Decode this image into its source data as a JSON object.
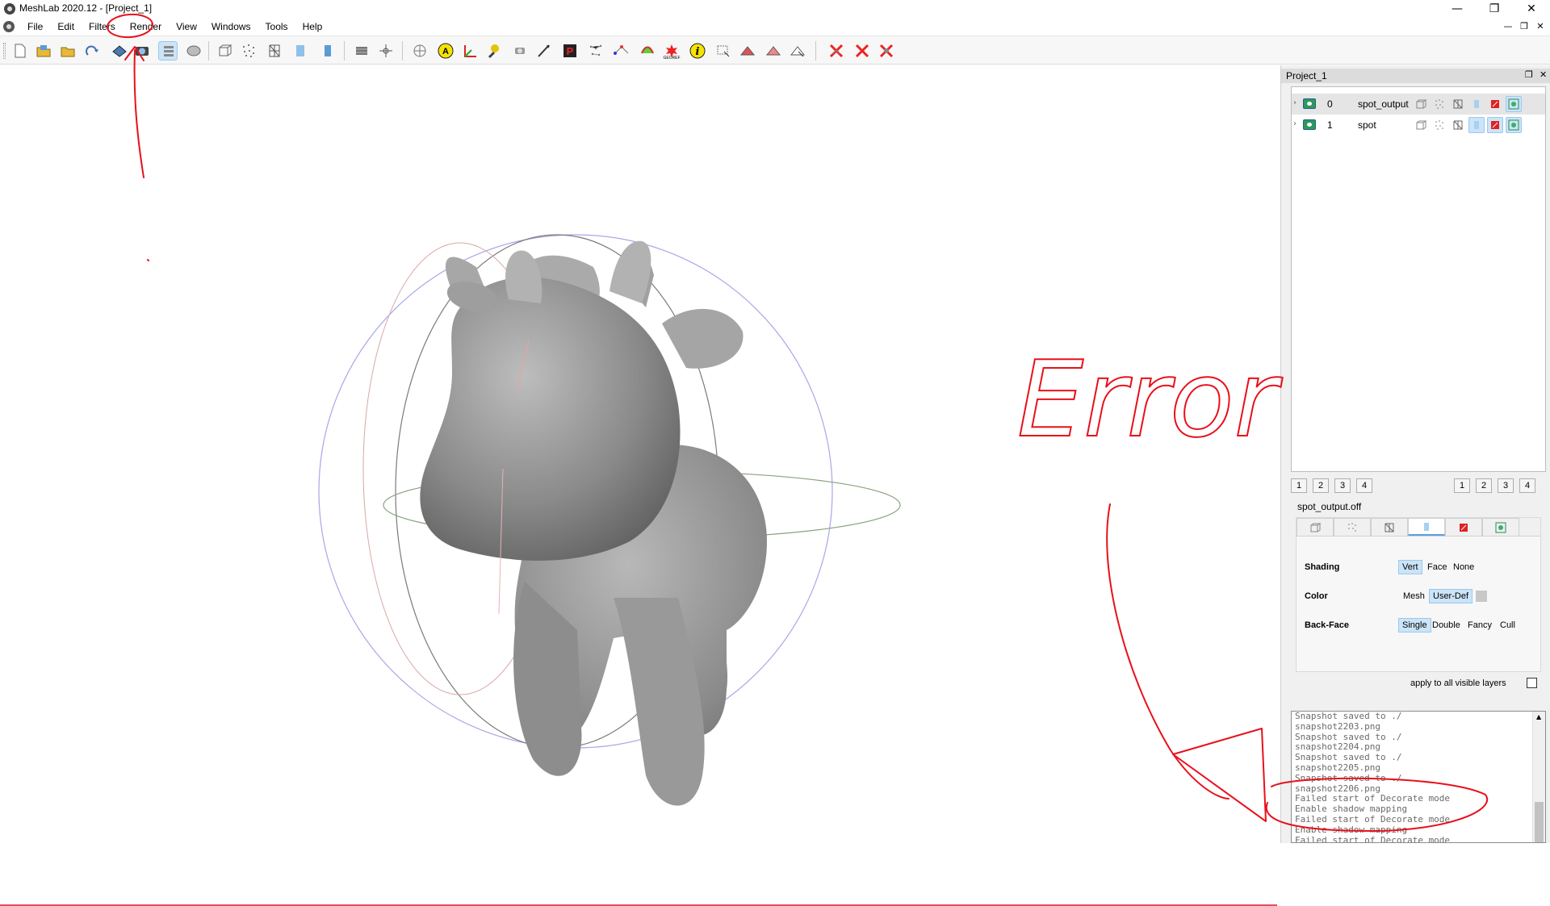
{
  "window": {
    "title": "MeshLab 2020.12 - [Project_1]",
    "controls": [
      "—",
      "❐",
      "✕"
    ],
    "mdi_controls": [
      "—",
      "❐",
      "✕"
    ]
  },
  "menu": [
    "File",
    "Edit",
    "Filters",
    "Render",
    "View",
    "Windows",
    "Tools",
    "Help"
  ],
  "toolbar_icons": [
    "new-project-icon",
    "import-mesh-icon",
    "open-project-icon",
    "reload-icon",
    "export-mesh-icon",
    "snapshot-icon",
    "fullscreen-layers-icon",
    "raster-icon",
    "bounding-box-icon",
    "points-icon",
    "wireframe-icon",
    "smooth-shading-icon",
    "texture-icon",
    "lighting-icon",
    "trackball-icon",
    "show-axis-icon",
    "selection-icon",
    "measure-icon",
    "paint-icon",
    "pick-points-icon",
    "align-icon",
    "georef-icon",
    "info-icon",
    "select-faces-icon",
    "select-vertices-icon",
    "connected-select-icon",
    "delete-icon",
    "delete-faces-icon",
    "delete-vertices-icon"
  ],
  "panel": {
    "title": "Project_1",
    "layers": [
      {
        "id": "0",
        "name": "spot_output"
      },
      {
        "id": "1",
        "name": "spot"
      }
    ],
    "viewport_tabs_left": [
      "1",
      "2",
      "3",
      "4"
    ],
    "viewport_tabs_right": [
      "1",
      "2",
      "3",
      "4"
    ],
    "mesh_name": "spot_output.off",
    "render": {
      "shading_label": "Shading",
      "shading_options": [
        "Vert",
        "Face",
        "None"
      ],
      "color_label": "Color",
      "color_options": [
        "Mesh",
        "User-Def"
      ],
      "backface_label": "Back-Face",
      "backface_options": [
        "Single",
        "Double",
        "Fancy",
        "Cull"
      ]
    },
    "apply_label": "apply to all visible layers",
    "log": [
      "Snapshot saved to ./",
      "snapshot2203.png",
      "Snapshot saved to ./",
      "snapshot2204.png",
      "Snapshot saved to ./",
      "snapshot2205.png",
      "Snapshot saved to ./",
      "snapshot2206.png",
      "Failed start of Decorate mode",
      "Enable shadow mapping",
      "Failed start of Decorate mode",
      "Enable shadow mapping",
      "Failed start of Decorate mode"
    ]
  },
  "annotation": {
    "text": "Error",
    "color": "#e8101a"
  },
  "colors": {
    "accent": "#cce4f7",
    "selection": "#99c9ef",
    "mesh": "#8f8f8f"
  }
}
